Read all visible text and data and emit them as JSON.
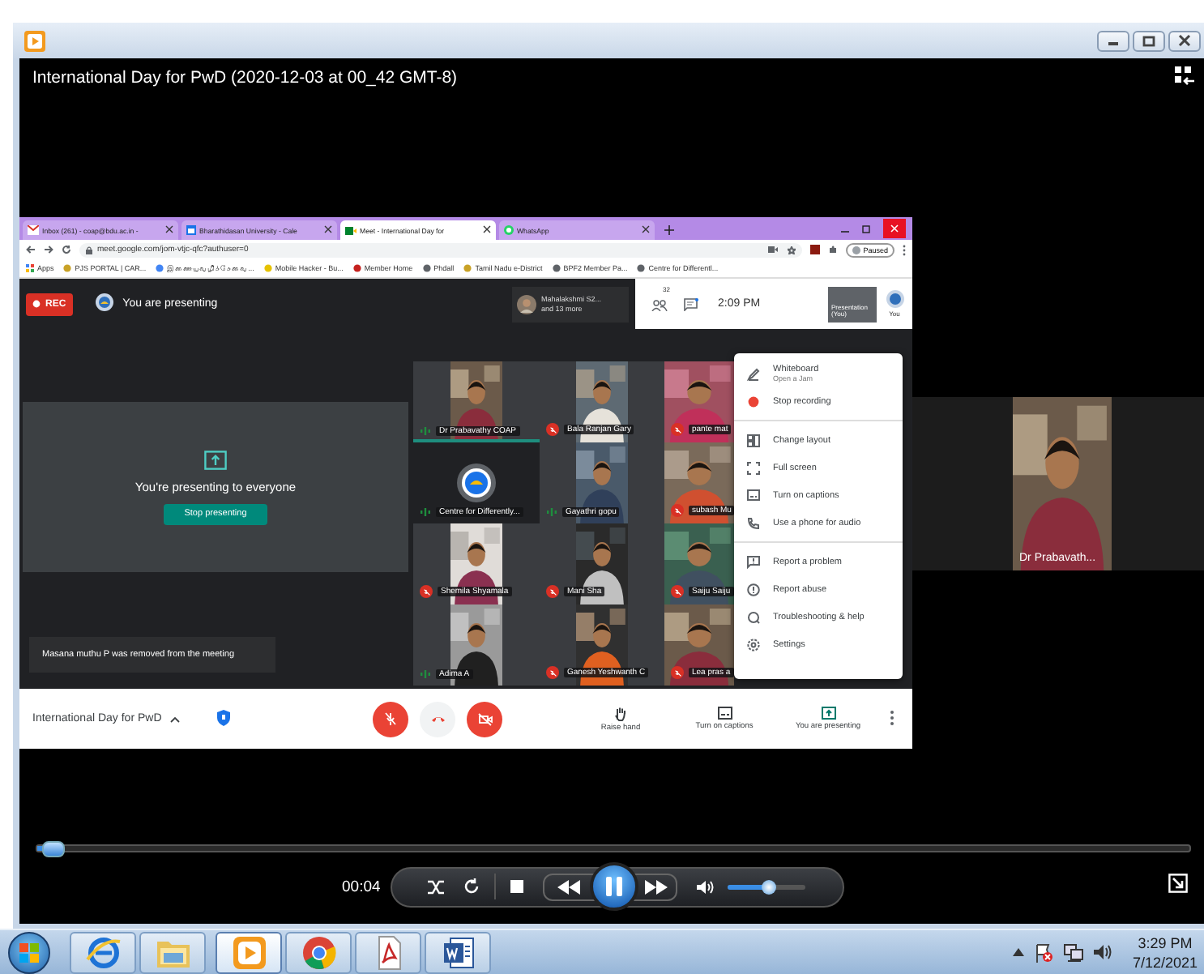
{
  "window": {
    "title": "International Day for PwD (2020-12-03 at 00_42 GMT-8)"
  },
  "browser": {
    "tabs": [
      {
        "label": "Inbox (261) - coap@bdu.ac.in -",
        "kind": "mail",
        "selected": false
      },
      {
        "label": "Bharathidasan University - Cale",
        "kind": "calendar",
        "selected": false
      },
      {
        "label": "Meet - International Day for",
        "kind": "meet",
        "selected": true
      },
      {
        "label": "WhatsApp",
        "kind": "whatsapp",
        "selected": false
      }
    ],
    "address": "meet.google.com/jom-vtjc-qfc?authuser=0",
    "profile": "Paused",
    "bookmarks": [
      "Apps",
      "PJS PORTAL | CAR...",
      "இணையவழிச்சேவை...",
      "Mobile Hacker - Bu...",
      "Member Home",
      "Phdall",
      "Tamil Nadu e-District",
      "BPF2 Member Pa...",
      "Centre for Differentl..."
    ]
  },
  "meet": {
    "recording": "REC",
    "presenting_label": "You are presenting",
    "preview": {
      "name": "Mahalakshmi S2...",
      "more": "and 13 more"
    },
    "people_count": "32",
    "time": "2:09 PM",
    "presentation_label": "Presentation (You)",
    "self_label": "You",
    "presenting_card": {
      "message": "You're presenting to everyone",
      "button": "Stop presenting"
    },
    "toast": "Masana muthu P was removed from the meeting",
    "tiles": [
      {
        "name": "Dr Prabavathy COAP",
        "kind": "video",
        "muted": false,
        "speaking": true
      },
      {
        "name": "Bala Ranjan Gary",
        "kind": "video",
        "muted": true,
        "speaking": false
      },
      {
        "name": "pante mat",
        "kind": "video",
        "muted": true,
        "speaking": false
      },
      {
        "name": "Centre for Differently...",
        "kind": "logo",
        "muted": false,
        "speaking": false
      },
      {
        "name": "Gayathri gopu",
        "kind": "video",
        "muted": false,
        "speaking": false
      },
      {
        "name": "subash Mu",
        "kind": "video",
        "muted": true,
        "speaking": false
      },
      {
        "name": "Shemila Shyamala",
        "kind": "video",
        "muted": true,
        "speaking": false
      },
      {
        "name": "Mani Sha",
        "kind": "video",
        "muted": true,
        "speaking": false
      },
      {
        "name": "Saiju Saiju",
        "kind": "video",
        "muted": true,
        "speaking": false
      },
      {
        "name": "Adima A",
        "kind": "video",
        "muted": false,
        "speaking": false
      },
      {
        "name": "Ganesh Yeshwanth C",
        "kind": "video",
        "muted": true,
        "speaking": false
      },
      {
        "name": "Lea pras a",
        "kind": "video",
        "muted": true,
        "speaking": false
      }
    ],
    "menu": {
      "groups": [
        {
          "items": [
            {
              "label": "Whiteboard",
              "sublabel": "Open a Jam",
              "kind": "pen"
            },
            {
              "label": "Stop recording",
              "kind": "record"
            }
          ]
        },
        {
          "items": [
            {
              "label": "Change layout",
              "kind": "layout"
            },
            {
              "label": "Full screen",
              "kind": "fullscreen"
            },
            {
              "label": "Turn on captions",
              "kind": "captions"
            },
            {
              "label": "Use a phone for audio",
              "kind": "phone"
            }
          ]
        },
        {
          "items": [
            {
              "label": "Report a problem",
              "kind": "report"
            },
            {
              "label": "Report abuse",
              "kind": "abuse"
            },
            {
              "label": "Troubleshooting & help",
              "kind": "help"
            },
            {
              "label": "Settings",
              "kind": "settings"
            }
          ]
        }
      ]
    },
    "bottom_bar": {
      "meeting_name": "International Day for PwD",
      "actions": [
        {
          "label": "Raise hand",
          "kind": "hand"
        },
        {
          "label": "Turn on captions",
          "kind": "captions"
        },
        {
          "label": "You are presenting",
          "kind": "present"
        }
      ]
    },
    "spotlight": {
      "name": "Dr Prabavath..."
    }
  },
  "transport": {
    "time": "00:04",
    "playing": true,
    "seek": {
      "level": 0.01
    },
    "volume": {
      "level": 0.52
    }
  },
  "taskbar": {
    "apps": [
      {
        "kind": "ie",
        "selected": false
      },
      {
        "kind": "explorer",
        "selected": false
      },
      {
        "kind": "wmp",
        "selected": true
      },
      {
        "kind": "chrome",
        "selected": false
      },
      {
        "kind": "pdf",
        "selected": false
      },
      {
        "kind": "word",
        "selected": false
      }
    ],
    "clock": {
      "time": "3:29 PM",
      "date": "7/12/2021"
    }
  }
}
